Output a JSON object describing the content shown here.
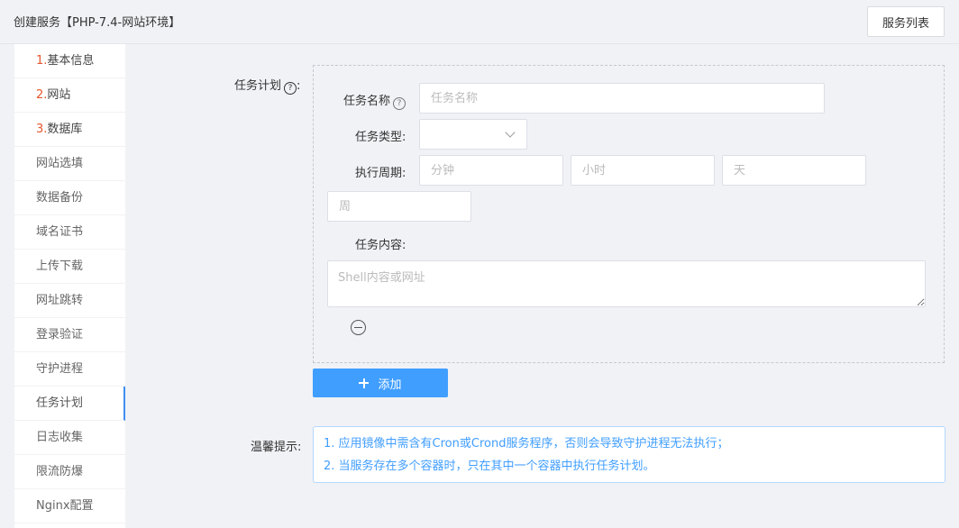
{
  "header": {
    "title": "创建服务【PHP-7.4-网站环境】",
    "service_list_button": "服务列表"
  },
  "sidebar": {
    "items": [
      {
        "num": "1.",
        "label": "基本信息"
      },
      {
        "num": "2.",
        "label": "网站"
      },
      {
        "num": "3.",
        "label": "数据库"
      },
      {
        "num": "",
        "label": "网站选填"
      },
      {
        "num": "",
        "label": "数据备份"
      },
      {
        "num": "",
        "label": "域名证书"
      },
      {
        "num": "",
        "label": "上传下载"
      },
      {
        "num": "",
        "label": "网址跳转"
      },
      {
        "num": "",
        "label": "登录验证"
      },
      {
        "num": "",
        "label": "守护进程"
      },
      {
        "num": "",
        "label": "任务计划"
      },
      {
        "num": "",
        "label": "日志收集"
      },
      {
        "num": "",
        "label": "限流防爆"
      },
      {
        "num": "",
        "label": "Nginx配置"
      }
    ],
    "active_item": "任务计划"
  },
  "form": {
    "section_label": "任务计划",
    "section_colon": ":",
    "task_name_label": "任务名称",
    "task_name_placeholder": "任务名称",
    "task_type_label": "任务类型:",
    "task_type_value": "",
    "period_label": "执行周期:",
    "minute_placeholder": "分钟",
    "hour_placeholder": "小时",
    "day_placeholder": "天",
    "week_placeholder": "周",
    "content_label": "任务内容:",
    "content_placeholder": "Shell内容或网址",
    "add_button": "添加"
  },
  "tips": {
    "label": "温馨提示:",
    "lines": [
      "1. 应用镜像中需含有Cron或Crond服务程序，否则会导致守护进程无法执行；",
      "2. 当服务存在多个容器时，只在其中一个容器中执行任务计划。"
    ]
  },
  "colors": {
    "accent": "#409eff",
    "step_number": "#e4572e",
    "tip_border": "#b3d8ff"
  }
}
